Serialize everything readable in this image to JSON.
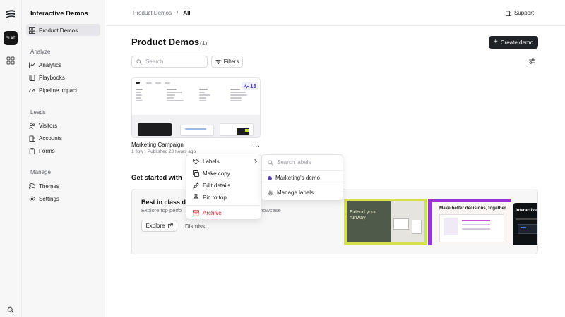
{
  "workspace": {
    "badge": "ƎLAI"
  },
  "sidebar": {
    "title": "Interactive Demos",
    "active_item": "Product Demos",
    "sections": [
      {
        "label": "Analyze",
        "items": [
          "Analytics",
          "Playbooks",
          "Pipeline impact"
        ]
      },
      {
        "label": "Leads",
        "items": [
          "Visitors",
          "Accounts",
          "Forms"
        ]
      },
      {
        "label": "Manage",
        "items": [
          "Themes",
          "Settings"
        ]
      }
    ]
  },
  "breadcrumb": {
    "parent": "Product Demos",
    "separator": "/",
    "current": "All"
  },
  "header": {
    "support_label": "Support"
  },
  "main": {
    "title": "Product Demos",
    "count": "(1)",
    "create_label": "Create demo",
    "search_placeholder": "Search",
    "filters_label": "Filters"
  },
  "card": {
    "steps": "18",
    "title": "Marketing Campaign",
    "meta": "1 flow · Published 20 hours ago",
    "more": "···"
  },
  "get_started": {
    "heading": "Get started with",
    "banner_title": "Best in class de",
    "banner_sub": "Explore top perfo",
    "banner_sub_tail": "mer showcase",
    "explore_label": "Explore",
    "dismiss_label": "Dismiss",
    "shot1_text": "Extend your runway",
    "shot2_text": "Make better decisions, together",
    "shot3_text": "Interactive"
  },
  "context_menu": {
    "items": [
      "Labels",
      "Make copy",
      "Edit details",
      "Pin to top"
    ],
    "danger_item": "Archive"
  },
  "labels_submenu": {
    "search_placeholder": "Search labels",
    "label_name": "Marketing's demo",
    "label_color": "#5a3fc0",
    "manage_label": "Manage labels"
  },
  "colors": {
    "accent": "#5a3fc0",
    "danger": "#c53030",
    "primary_button": "#1f2328"
  }
}
